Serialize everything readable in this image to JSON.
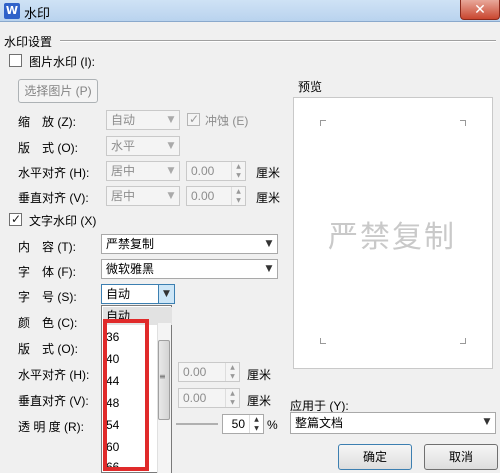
{
  "window": {
    "title": "水印",
    "app_icon_letter": "W",
    "close_glyph": "✕"
  },
  "settings": {
    "group_title": "水印设置",
    "picture": {
      "checkbox_label": "图片水印 (I):",
      "checked": false,
      "select_button": "选择图片 (P)",
      "scale_label": "缩　放 (Z):",
      "scale_value": "自动",
      "washout_label": "冲蚀 (E)",
      "layout_label": "版　式 (O):",
      "layout_value": "水平",
      "halign_label": "水平对齐 (H):",
      "halign_value": "居中",
      "halign_offset": "0.00",
      "valign_label": "垂直对齐 (V):",
      "valign_value": "居中",
      "valign_offset": "0.00",
      "unit": "厘米"
    },
    "text": {
      "checkbox_label": "文字水印 (X)",
      "checked": true,
      "content_label": "内　容 (T):",
      "content_value": "严禁复制",
      "font_label": "字　体 (F):",
      "font_value": "微软雅黑",
      "size_label": "字　号 (S):",
      "size_value": "自动",
      "color_label": "颜　色 (C):",
      "layout_label": "版　式 (O):",
      "halign_label": "水平对齐 (H):",
      "halign_offset": "0.00",
      "valign_label": "垂直对齐 (V):",
      "valign_offset": "0.00",
      "transparency_label": "透 明 度 (R):",
      "transparency_value": "50",
      "percent": "%",
      "unit": "厘米"
    }
  },
  "size_dropdown": {
    "options": [
      "自动",
      "36",
      "40",
      "44",
      "48",
      "54",
      "60",
      "66"
    ],
    "selected_index": 0
  },
  "preview": {
    "label": "预览",
    "watermark_text": "严禁复制"
  },
  "apply": {
    "label": "应用于 (Y):",
    "value": "整篇文档"
  },
  "buttons": {
    "ok": "确定",
    "cancel": "取消"
  }
}
